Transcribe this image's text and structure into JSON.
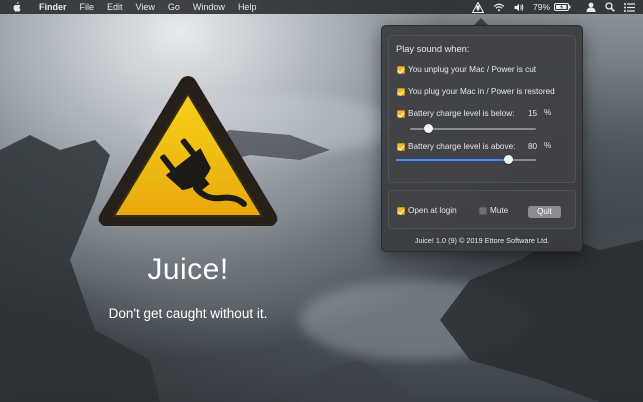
{
  "menubar": {
    "apple_icon": "apple-logo-icon",
    "app_name": "Finder",
    "menus": [
      "File",
      "Edit",
      "View",
      "Go",
      "Window",
      "Help"
    ],
    "status": {
      "juice_icon": "plug-warning-icon",
      "wifi_icon": "wifi-icon",
      "volume_icon": "speaker-icon",
      "battery_percent": "79%",
      "battery_icon": "battery-charging-icon",
      "search_icon": "spotlight-search-icon",
      "user_icon": "user-icon",
      "list_icon": "notification-center-icon"
    }
  },
  "hero": {
    "logo_icon": "warning-triangle-plug-icon",
    "title": "Juice!",
    "tagline": "Don't get caught without it."
  },
  "popover": {
    "heading": "Play sound when:",
    "options": {
      "unplug": {
        "label": "You unplug your Mac / Power is cut",
        "checked": true
      },
      "plug": {
        "label": "You plug your Mac in / Power is restored",
        "checked": true
      },
      "below": {
        "label": "Battery charge level is below:",
        "value": "15",
        "unit": "%",
        "checked": true,
        "level": 15
      },
      "above": {
        "label": "Battery charge level is above:",
        "value": "80",
        "unit": "%",
        "checked": true,
        "level": 80
      }
    },
    "open_at_login": {
      "label": "Open at login",
      "checked": true
    },
    "mute": {
      "label": "Mute",
      "checked": false
    },
    "quit_label": "Quit",
    "footer": "Juice! 1.0 (9) © 2019 Ettore Software Ltd."
  },
  "colors": {
    "accent_yellow": "#f2b928",
    "slider_blue": "#3f8cf3",
    "menubar_bg": "#28292e",
    "popover_bg": "#3a3c3f"
  }
}
